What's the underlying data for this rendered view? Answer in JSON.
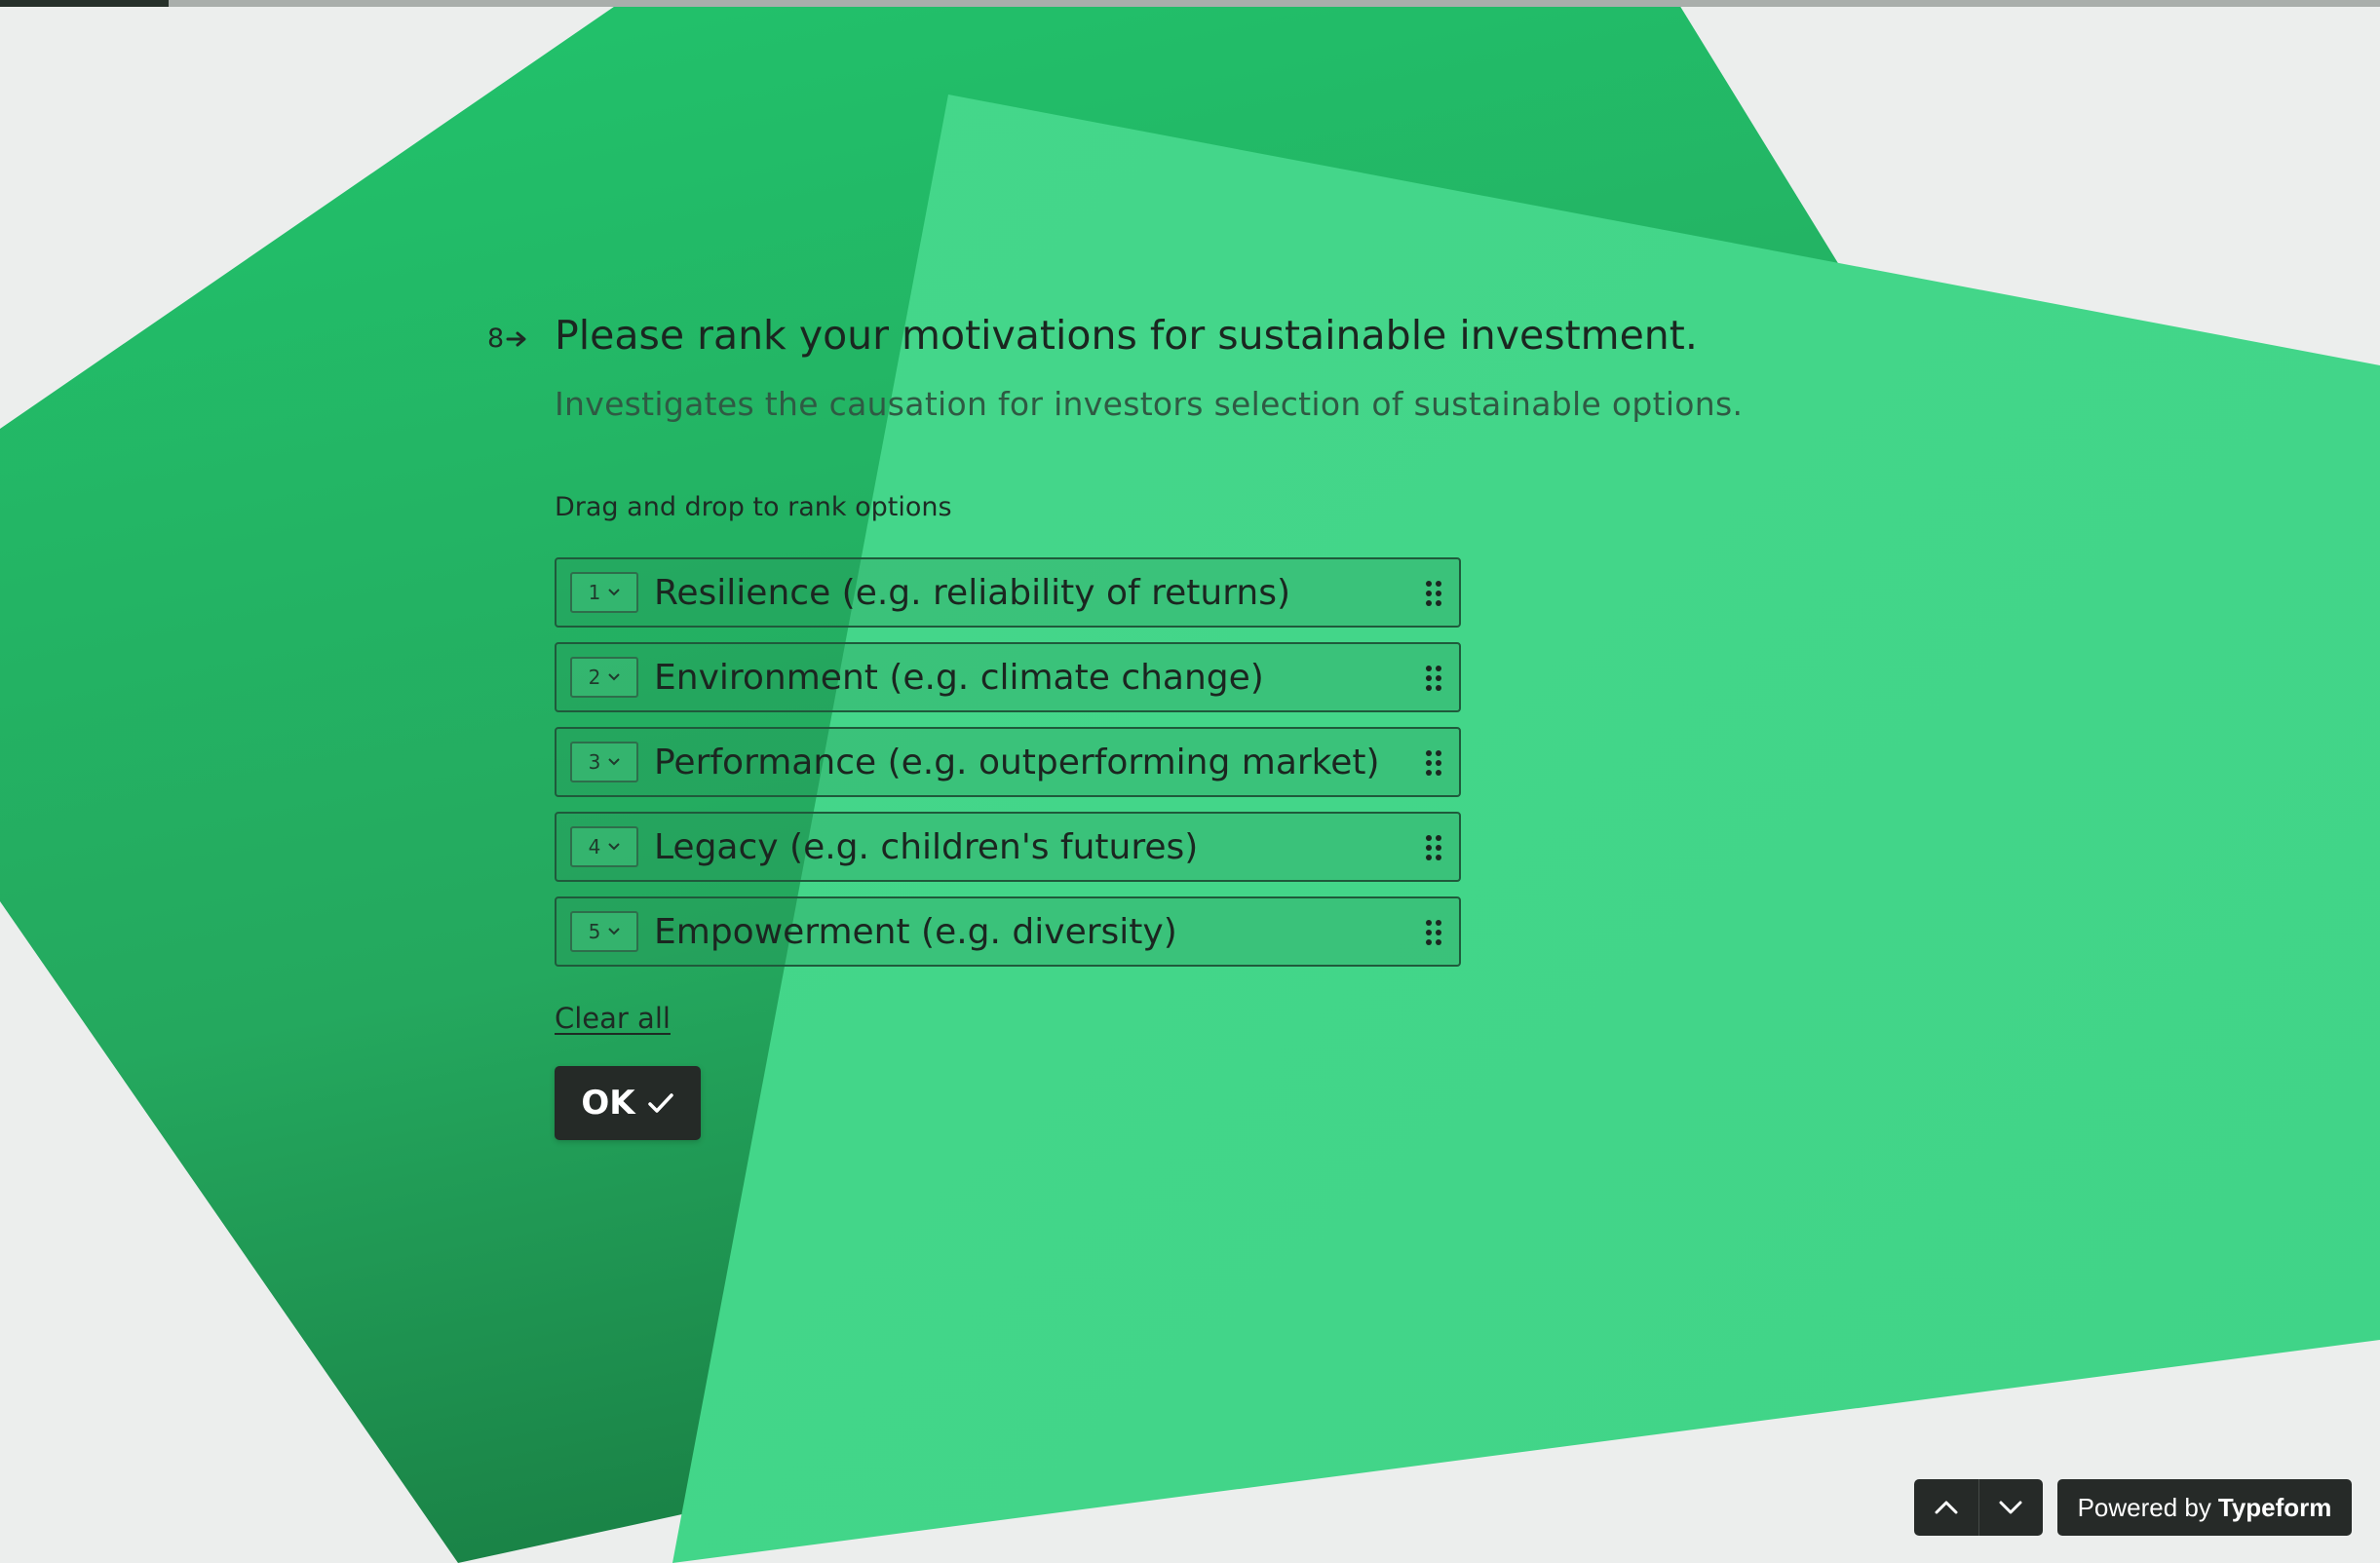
{
  "progress": {
    "fraction": 0.071
  },
  "colors": {
    "background": "#eceeed",
    "shape_dark": "#22bb66",
    "shape_light": "#46d88b",
    "text": "#1b2620",
    "button": "#252a27"
  },
  "question": {
    "number": "8",
    "title": "Please rank your motivations for sustainable investment.",
    "description": "Investigates the causation for investors selection of sustainable options.",
    "hint": "Drag and drop to rank options"
  },
  "options": [
    {
      "rank": "1",
      "label": "Resilience (e.g. reliability of returns)"
    },
    {
      "rank": "2",
      "label": "Environment (e.g. climate change)"
    },
    {
      "rank": "3",
      "label": "Performance (e.g. outperforming market)"
    },
    {
      "rank": "4",
      "label": "Legacy (e.g. children's futures)"
    },
    {
      "rank": "5",
      "label": "Empowerment (e.g. diversity)"
    }
  ],
  "clear_all": "Clear all",
  "ok_button": {
    "label": "OK"
  },
  "footer": {
    "powered_prefix": "Powered by",
    "powered_brand": "Typeform",
    "nav_icons": [
      "chevron-up-icon",
      "chevron-down-icon"
    ]
  }
}
